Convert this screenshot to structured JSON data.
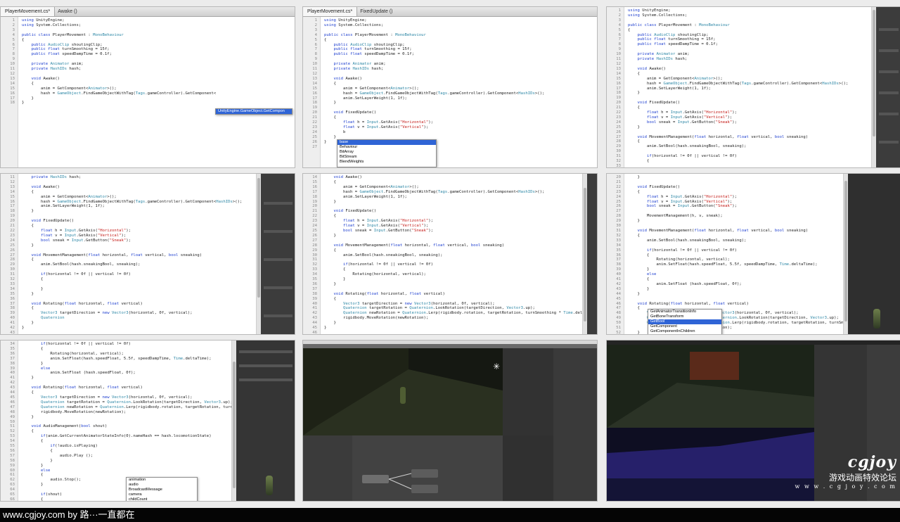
{
  "tiles": {
    "t1": {
      "tab": "PlayerMovement.cs*",
      "crumb": "Awake ()",
      "lines": [
        [
          "1",
          "using UnityEngine;"
        ],
        [
          "2",
          "using System.Collections;"
        ],
        [
          "3",
          ""
        ],
        [
          "4",
          "public class PlayerMovement : MonoBehaviour"
        ],
        [
          "5",
          "{"
        ],
        [
          "6",
          "    public AudioClip shoutingClip;"
        ],
        [
          "7",
          "    public float turnSmoothing = 15f;"
        ],
        [
          "8",
          "    public float speedDampTime = 0.1f;"
        ],
        [
          "9",
          ""
        ],
        [
          "10",
          "    private Animator anim;"
        ],
        [
          "11",
          "    private HashIDs hash;"
        ],
        [
          "12",
          ""
        ],
        [
          "13",
          "    void Awake()"
        ],
        [
          "14",
          "    {"
        ],
        [
          "15",
          "        anim = GetComponent<Animator>();"
        ],
        [
          "16",
          "        hash = GameObject.FindGameObjectWithTag(Tags.gameController).GetComponent<"
        ],
        [
          "17",
          "    }"
        ],
        [
          "18",
          "}"
        ]
      ],
      "popup": [
        "UnityEngine.GameObject.GetCompon"
      ]
    },
    "t2": {
      "tab": "PlayerMovement.cs*",
      "crumb": "FixedUpdate ()",
      "lines": [
        [
          "1",
          "using UnityEngine;"
        ],
        [
          "2",
          "using System.Collections;"
        ],
        [
          "3",
          ""
        ],
        [
          "4",
          "public class PlayerMovement : MonoBehaviour"
        ],
        [
          "5",
          "{"
        ],
        [
          "6",
          "    public AudioClip shoutingClip;"
        ],
        [
          "7",
          "    public float turnSmoothing = 15f;"
        ],
        [
          "8",
          "    public float speedDampTime = 0.1f;"
        ],
        [
          "9",
          ""
        ],
        [
          "10",
          "    private Animator anim;"
        ],
        [
          "11",
          "    private HashIDs hash;"
        ],
        [
          "12",
          ""
        ],
        [
          "13",
          "    void Awake()"
        ],
        [
          "14",
          "    {"
        ],
        [
          "15",
          "        anim = GetComponent<Animator>();"
        ],
        [
          "16",
          "        hash = GameObject.FindGameObjectWithTag(Tags.gameController).GetComponent<HashIDs>();"
        ],
        [
          "17",
          "        anim.SetLayerWeight(1, 1f);"
        ],
        [
          "18",
          "    }"
        ],
        [
          "19",
          ""
        ],
        [
          "20",
          "    void FixedUpdate()"
        ],
        [
          "21",
          "    {"
        ],
        [
          "22",
          "        float h = Input.GetAxis(\"Horizontal\");"
        ],
        [
          "23",
          "        float v = Input.GetAxis(\"Vertical\");"
        ],
        [
          "24",
          "        b"
        ],
        [
          "25",
          "    }"
        ],
        [
          "26",
          "}"
        ],
        [
          "27",
          ""
        ]
      ],
      "popup": [
        "base",
        "Behaviour",
        "BitArray",
        "BitStream",
        "BlendWeights"
      ]
    },
    "t3": {
      "lines": [
        [
          "1",
          "using UnityEngine;"
        ],
        [
          "2",
          "using System.Collections;"
        ],
        [
          "3",
          ""
        ],
        [
          "4",
          "public class PlayerMovement : MonoBehaviour"
        ],
        [
          "5",
          "{"
        ],
        [
          "6",
          "    public AudioClip shoutingClip;"
        ],
        [
          "7",
          "    public float turnSmoothing = 15f;"
        ],
        [
          "8",
          "    public float speedDampTime = 0.1f;"
        ],
        [
          "9",
          ""
        ],
        [
          "10",
          "    private Animator anim;"
        ],
        [
          "11",
          "    private HashIDs hash;"
        ],
        [
          "12",
          ""
        ],
        [
          "13",
          "    void Awake()"
        ],
        [
          "14",
          "    {"
        ],
        [
          "15",
          "        anim = GetComponent<Animator>();"
        ],
        [
          "16",
          "        hash = GameObject.FindGameObjectWithTag(Tags.gameController).GetComponent<HashIDs>();"
        ],
        [
          "17",
          "        anim.SetLayerWeight(1, 1f);"
        ],
        [
          "18",
          "    }"
        ],
        [
          "19",
          ""
        ],
        [
          "20",
          "    void FixedUpdate()"
        ],
        [
          "21",
          "    {"
        ],
        [
          "22",
          "        float h = Input.GetAxis(\"Horizontal\");"
        ],
        [
          "23",
          "        float v = Input.GetAxis(\"Vertical\");"
        ],
        [
          "24",
          "        bool sneak = Input.GetButton(\"Sneak\");"
        ],
        [
          "25",
          "    }"
        ],
        [
          "26",
          ""
        ],
        [
          "27",
          "    void MovementManagement(float horizontal, float vertical, bool sneaking)"
        ],
        [
          "28",
          "    {"
        ],
        [
          "29",
          "        anim.SetBool(hash.sneakingBool, sneaking);"
        ],
        [
          "30",
          ""
        ],
        [
          "31",
          "        if(horizontal != 0f || vertical != 0f)"
        ],
        [
          "32",
          "        {"
        ],
        [
          "33",
          ""
        ],
        [
          "34",
          "        }"
        ],
        [
          "35",
          "    }"
        ],
        [
          "36",
          "}"
        ]
      ]
    },
    "t4": {
      "lines": [
        [
          "11",
          "    private HashIDs hash;"
        ],
        [
          "12",
          ""
        ],
        [
          "13",
          "    void Awake()"
        ],
        [
          "14",
          "    {"
        ],
        [
          "15",
          "        anim = GetComponent<Animator>();"
        ],
        [
          "16",
          "        hash = GameObject.FindGameObjectWithTag(Tags.gameController).GetComponent<HashIDs>();"
        ],
        [
          "17",
          "        anim.SetLayerWeight(1, 1f);"
        ],
        [
          "18",
          "    }"
        ],
        [
          "19",
          ""
        ],
        [
          "20",
          "    void FixedUpdate()"
        ],
        [
          "21",
          "    {"
        ],
        [
          "22",
          "        float h = Input.GetAxis(\"Horizontal\");"
        ],
        [
          "23",
          "        float v = Input.GetAxis(\"Vertical\");"
        ],
        [
          "24",
          "        bool sneak = Input.GetButton(\"Sneak\");"
        ],
        [
          "25",
          "    }"
        ],
        [
          "26",
          ""
        ],
        [
          "27",
          "    void MovementManagement(float horizontal, float vertical, bool sneaking)"
        ],
        [
          "28",
          "    {"
        ],
        [
          "29",
          "        anim.SetBool(hash.sneakingBool, sneaking);"
        ],
        [
          "30",
          ""
        ],
        [
          "31",
          "        if(horizontal != 0f || vertical != 0f)"
        ],
        [
          "32",
          "        {"
        ],
        [
          "33",
          ""
        ],
        [
          "34",
          "        }"
        ],
        [
          "35",
          "    }"
        ],
        [
          "36",
          ""
        ],
        [
          "37",
          "    void Rotating(float horizontal, float vertical)"
        ],
        [
          "38",
          "    {"
        ],
        [
          "39",
          "        Vector3 targetDirection = new Vector3(horizontal, 0f, vertical);"
        ],
        [
          "40",
          "        Quaternion"
        ],
        [
          "41",
          "    }"
        ],
        [
          "42",
          "}"
        ],
        [
          "43",
          ""
        ]
      ]
    },
    "t5": {
      "lines": [
        [
          "14",
          "    void Awake()"
        ],
        [
          "15",
          "    {"
        ],
        [
          "16",
          "        anim = GetComponent<Animator>();"
        ],
        [
          "17",
          "        hash = GameObject.FindGameObjectWithTag(Tags.gameController).GetComponent<HashIDs>();"
        ],
        [
          "18",
          "        anim.SetLayerWeight(1, 1f);"
        ],
        [
          "19",
          "    }"
        ],
        [
          "20",
          ""
        ],
        [
          "21",
          "    void FixedUpdate()"
        ],
        [
          "22",
          "    {"
        ],
        [
          "23",
          "        float h = Input.GetAxis(\"Horizontal\");"
        ],
        [
          "24",
          "        float v = Input.GetAxis(\"Vertical\");"
        ],
        [
          "25",
          "        bool sneak = Input.GetButton(\"Sneak\");"
        ],
        [
          "26",
          "    }"
        ],
        [
          "27",
          ""
        ],
        [
          "28",
          "    void MovementManagement(float horizontal, float vertical, bool sneaking)"
        ],
        [
          "29",
          "    {"
        ],
        [
          "30",
          "        anim.SetBool(hash.sneakingBool, sneaking);"
        ],
        [
          "31",
          ""
        ],
        [
          "32",
          "        if(horizontal != 0f || vertical != 0f)"
        ],
        [
          "33",
          "        {"
        ],
        [
          "34",
          "            Rotating(horizontal, vertical);"
        ],
        [
          "35",
          "        }"
        ],
        [
          "36",
          "    }"
        ],
        [
          "37",
          ""
        ],
        [
          "38",
          "    void Rotating(float horizontal, float vertical)"
        ],
        [
          "39",
          "    {"
        ],
        [
          "40",
          "        Vector3 targetDirection = new Vector3(horizontal, 0f, vertical);"
        ],
        [
          "41",
          "        Quaternion targetRotation = Quaternion.LookRotation(targetDirection, Vector3.up);"
        ],
        [
          "42",
          "        Quaternion newRotation = Quaternion.Lerp(rigidbody.rotation, targetRotation, turnSmoothing * Time.deltaTime);"
        ],
        [
          "43",
          "        rigidbody.MoveRotation(newRotation);"
        ],
        [
          "44",
          "    }"
        ],
        [
          "45",
          "}"
        ],
        [
          "46",
          ""
        ]
      ]
    },
    "t6": {
      "lines": [
        [
          "20",
          "    }"
        ],
        [
          "21",
          ""
        ],
        [
          "22",
          "    void FixedUpdate()"
        ],
        [
          "23",
          "    {"
        ],
        [
          "24",
          "        float h = Input.GetAxis(\"Horizontal\");"
        ],
        [
          "25",
          "        float v = Input.GetAxis(\"Vertical\");"
        ],
        [
          "26",
          "        bool sneak = Input.GetButton(\"Sneak\");"
        ],
        [
          "27",
          ""
        ],
        [
          "28",
          "        MovementManagement(h, v, sneak);"
        ],
        [
          "29",
          "    }"
        ],
        [
          "30",
          ""
        ],
        [
          "31",
          "    void MovementManagement(float horizontal, float vertical, bool sneaking)"
        ],
        [
          "32",
          "    {"
        ],
        [
          "33",
          "        anim.SetBool(hash.sneakingBool, sneaking);"
        ],
        [
          "34",
          ""
        ],
        [
          "35",
          "        if(horizontal != 0f || vertical != 0f)"
        ],
        [
          "36",
          "        {"
        ],
        [
          "37",
          "            Rotating(horizontal, vertical);"
        ],
        [
          "38",
          "            anim.SetFloat(hash.speedFloat, 5.5f, speedDampTime, Time.deltaTime);"
        ],
        [
          "39",
          "        }"
        ],
        [
          "40",
          "        else"
        ],
        [
          "41",
          "        {"
        ],
        [
          "42",
          "            anim.SetFloat (hash.speedFloat, 0f);"
        ],
        [
          "43",
          "        }"
        ],
        [
          "44",
          "    }"
        ],
        [
          "45",
          ""
        ],
        [
          "46",
          "    void Rotating(float horizontal, float vertical)"
        ],
        [
          "47",
          "    {"
        ],
        [
          "48",
          "        Vector3 targetDirection = new Vector3(horizontal, 0f, vertical);"
        ],
        [
          "49",
          "        Quaternion targetRotation = Quaternion.LookRotation(targetDirection, Vector3.up);"
        ],
        [
          "50",
          "        Quaternion newRotation = Quaternion.Lerp(rigidbody.rotation, targetRotation, turnSmoothing * Time.deltaTime);"
        ],
        [
          "51",
          "        rigidbody.MoveRotation(newRotation);"
        ],
        [
          "52",
          "    }"
        ],
        [
          "53",
          ""
        ],
        [
          "54",
          "    void AudioManagement(bool shout)"
        ],
        [
          "55",
          "    {"
        ],
        [
          "56",
          "        if(anim.Get"
        ],
        [
          "57",
          "    }"
        ],
        [
          "58",
          "}"
        ]
      ],
      "popup": [
        "GetAnimatorTransitionInfo",
        "GetBoneTransform",
        "GetBool",
        "GetComponent",
        "GetComponentInChildren"
      ]
    },
    "t7": {
      "lines": [
        [
          "34",
          "        if(horizontal != 0f || vertical != 0f)"
        ],
        [
          "35",
          "        {"
        ],
        [
          "36",
          "            Rotating(horizontal, vertical);"
        ],
        [
          "37",
          "            anim.SetFloat(hash.speedFloat, 5.5f, speedDampTime, Time.deltaTime);"
        ],
        [
          "38",
          "        }"
        ],
        [
          "39",
          "        else"
        ],
        [
          "40",
          "            anim.SetFloat (hash.speedFloat, 0f);"
        ],
        [
          "41",
          "    }"
        ],
        [
          "42",
          ""
        ],
        [
          "43",
          "    void Rotating(float horizontal, float vertical)"
        ],
        [
          "44",
          "    {"
        ],
        [
          "45",
          "        Vector3 targetDirection = new Vector3(horizontal, 0f, vertical);"
        ],
        [
          "46",
          "        Quaternion targetRotation = Quaternion.LookRotation(targetDirection, Vector3.up);"
        ],
        [
          "47",
          "        Quaternion newRotation = Quaternion.Lerp(rigidbody.rotation, targetRotation, turnSmoothing * Time.deltaTime);"
        ],
        [
          "48",
          "        rigidbody.MoveRotation(newRotation);"
        ],
        [
          "49",
          "    }"
        ],
        [
          "50",
          ""
        ],
        [
          "51",
          "    void AudioManagement(bool shout)"
        ],
        [
          "52",
          "    {"
        ],
        [
          "53",
          "        if(anim.GetCurrentAnimatorStateInfo(0).nameHash == hash.locomotionState)"
        ],
        [
          "54",
          "        {"
        ],
        [
          "55",
          "            if(!audio.isPlaying)"
        ],
        [
          "56",
          "            {"
        ],
        [
          "57",
          "                audio.Play ();"
        ],
        [
          "58",
          "            }"
        ],
        [
          "59",
          "        }"
        ],
        [
          "60",
          "        else"
        ],
        [
          "61",
          "        {"
        ],
        [
          "62",
          "            audio.Stop();"
        ],
        [
          "63",
          "        }"
        ],
        [
          "64",
          ""
        ],
        [
          "65",
          "        if(shout)"
        ],
        [
          "66",
          "        {"
        ],
        [
          "67",
          "            AudioSource.PlayClipAtPoint(shoutingClip, transform"
        ],
        [
          "68",
          "        }"
        ],
        [
          "69",
          "    }"
        ]
      ],
      "popup": [
        "animation",
        "audio",
        "BroadcastMessage",
        "camera",
        "childCount"
      ]
    }
  },
  "footer": {
    "credit": "www.cgjoy.com by 路···一直都在"
  },
  "watermark": {
    "logo": "cgjoy",
    "tagline": "游戏动画特效论坛",
    "url": "w w w . c g j o y . c o m"
  },
  "colors": {
    "keyword": "#1d3ecf",
    "string": "#c41a16",
    "class": "#2b86a5",
    "unity_dark": "#3c3c3c",
    "footer_bg": "#050505"
  }
}
